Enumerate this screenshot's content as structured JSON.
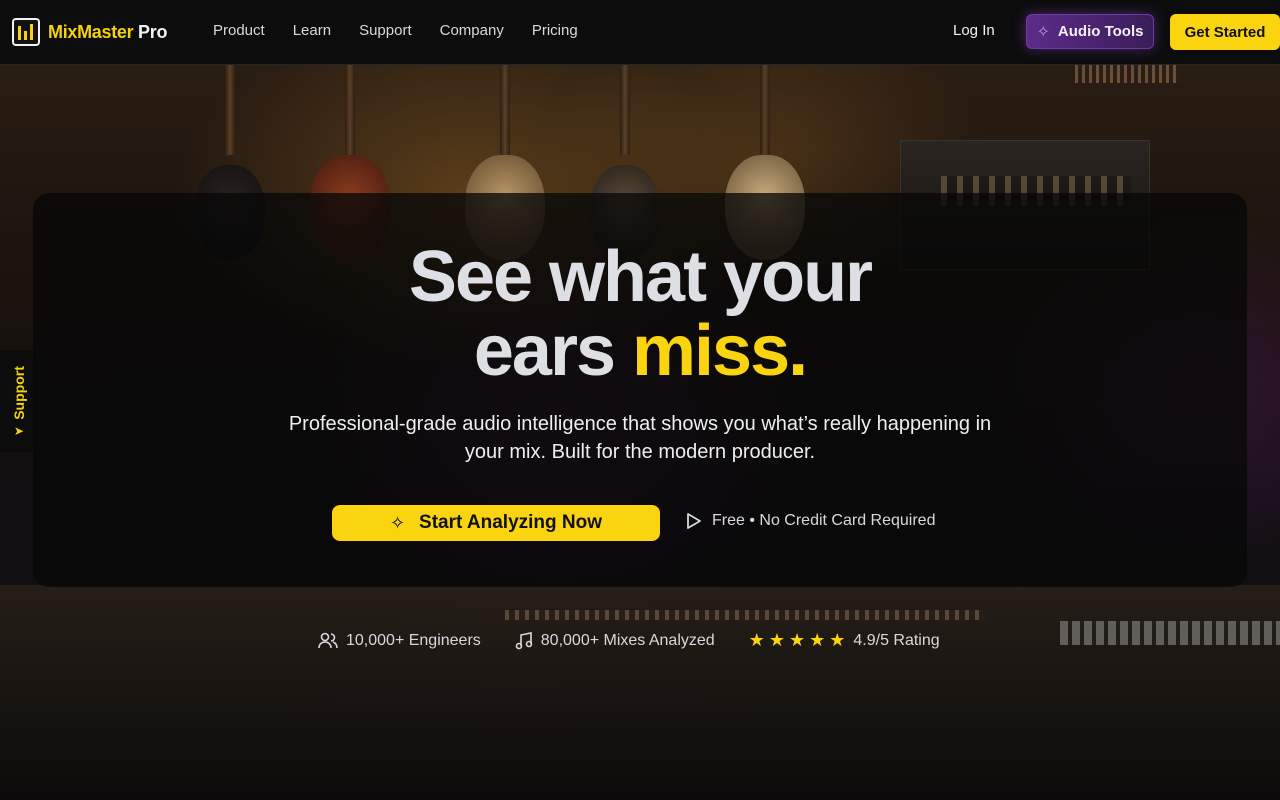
{
  "brand": {
    "name_part1": "MixMaster",
    "name_part2": " Pro",
    "accent": "#f9d40f"
  },
  "nav": {
    "items": [
      {
        "label": "Product"
      },
      {
        "label": "Learn"
      },
      {
        "label": "Support"
      },
      {
        "label": "Company"
      },
      {
        "label": "Pricing"
      }
    ],
    "login_label": "Log In",
    "audio_tools_label": "Audio Tools",
    "get_started_label": "Get Started"
  },
  "support_tab": {
    "label": "Support",
    "icon": "arrow-icon"
  },
  "hero": {
    "headline_line1": "See what your",
    "headline_line2_plain": "ears ",
    "headline_line2_highlight": "miss.",
    "subtitle": "Professional-grade audio intelligence that shows you what’s really happening in your mix. Built for the modern producer.",
    "cta_label": "Start Analyzing Now",
    "note": "Free • No Credit Card Required"
  },
  "stats": {
    "engineers": "10,000+ Engineers",
    "mixes": "80,000+ Mixes Analyzed",
    "rating_stars": 5,
    "rating": "4.9/5 Rating"
  },
  "colors": {
    "background": "#0b0b0b",
    "cta": "#f9d40f",
    "purple": "#5c2b8a"
  }
}
